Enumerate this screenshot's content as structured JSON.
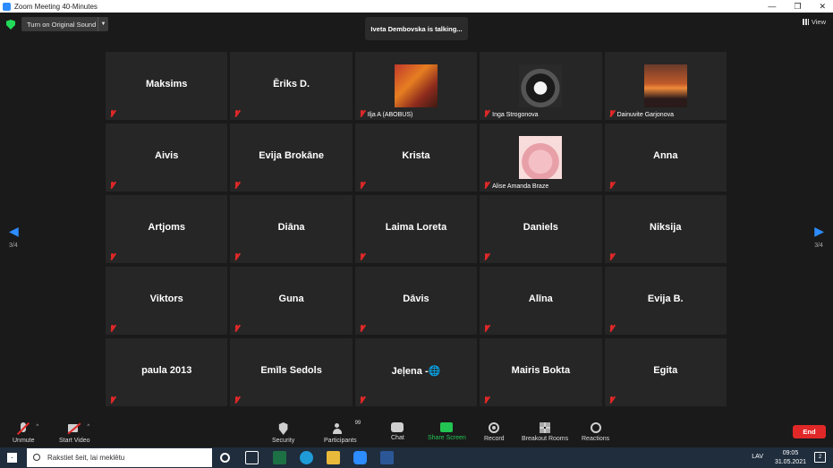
{
  "window": {
    "title": "Zoom Meeting 40-Minutes",
    "minimize": "—",
    "restore": "❐",
    "close": "✕"
  },
  "topbar": {
    "original_sound": "Turn on Original Sound",
    "talking": "Iveta Dembovska is talking...",
    "view": "View"
  },
  "pager": {
    "left": "3/4",
    "right": "3/4"
  },
  "tiles": [
    {
      "name": "Maksims",
      "label": ""
    },
    {
      "name": "Ēriks D.",
      "label": ""
    },
    {
      "name": "",
      "label": "Ilja A (ABOBUS)",
      "photo": "ph-anime"
    },
    {
      "name": "",
      "label": "Inga Strogonova",
      "photo": "ph-cat"
    },
    {
      "name": "",
      "label": "Dainuvite Garjonova",
      "photo": "ph-sunset"
    },
    {
      "name": "Aivis",
      "label": ""
    },
    {
      "name": "Evija Brokāne",
      "label": ""
    },
    {
      "name": "Krista",
      "label": ""
    },
    {
      "name": "",
      "label": "Alise Amanda Braze",
      "photo": "ph-pink"
    },
    {
      "name": "Anna",
      "label": ""
    },
    {
      "name": "Artjoms",
      "label": ""
    },
    {
      "name": "Diāna",
      "label": ""
    },
    {
      "name": "Laima Loreta",
      "label": ""
    },
    {
      "name": "Daniels",
      "label": ""
    },
    {
      "name": "Niksija",
      "label": ""
    },
    {
      "name": "Viktors",
      "label": ""
    },
    {
      "name": "Guna",
      "label": ""
    },
    {
      "name": "Dāvis",
      "label": ""
    },
    {
      "name": "Alīna",
      "label": ""
    },
    {
      "name": "Evija B.",
      "label": ""
    },
    {
      "name": "paula  2013",
      "label": ""
    },
    {
      "name": "Emīls Sedols",
      "label": ""
    },
    {
      "name": "Jeļena -🌐",
      "label": ""
    },
    {
      "name": "Mairis Bokta",
      "label": ""
    },
    {
      "name": "Egita",
      "label": ""
    }
  ],
  "controls": {
    "unmute": "Unmute",
    "start_video": "Start Video",
    "security": "Security",
    "participants": "Participants",
    "participants_count": "99",
    "chat": "Chat",
    "share_screen": "Share Screen",
    "record": "Record",
    "breakout": "Breakout Rooms",
    "reactions": "Reactions",
    "end": "End"
  },
  "taskbar": {
    "search_placeholder": "Rakstiet šeit, lai meklētu",
    "lang": "LAV",
    "time": "09:05",
    "date": "31.05.2021",
    "notif_count": "2"
  },
  "colors": {
    "accent": "#2d8cff",
    "end": "#e02828",
    "share": "#23c552",
    "muted": "#e02828"
  }
}
